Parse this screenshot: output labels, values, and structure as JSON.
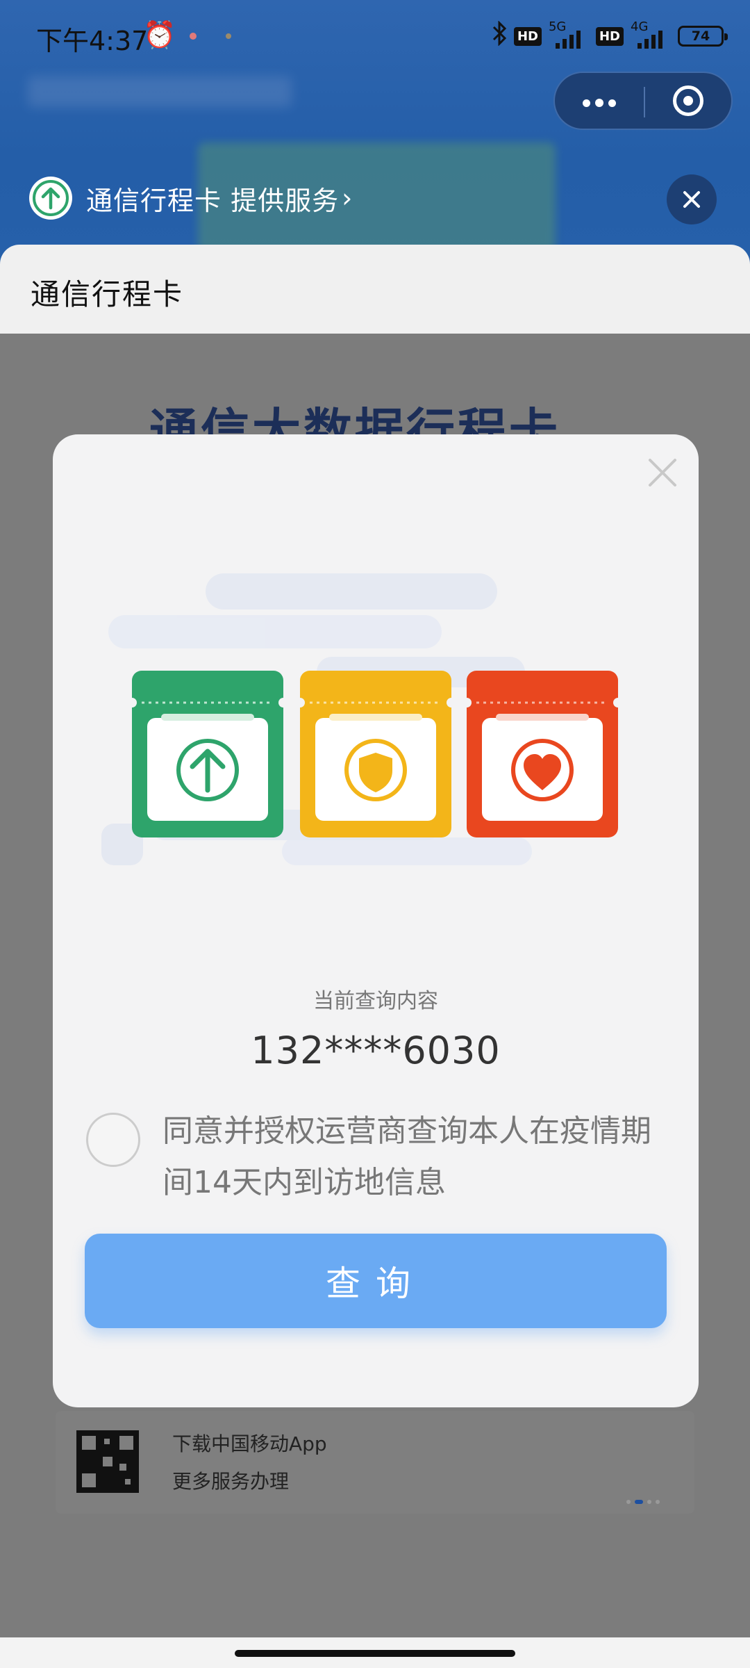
{
  "status_bar": {
    "time": "下午4:37",
    "net1": "5G",
    "net2": "4G",
    "hd": "HD",
    "battery": "74"
  },
  "provider_bar": {
    "text": "通信行程卡 提供服务",
    "chevron": "›"
  },
  "sheet": {
    "title": "通信行程卡",
    "background_heading": "通信大数据行程卡"
  },
  "modal": {
    "current_query_label": "当前查询内容",
    "phone_number": "132****6030",
    "consent_text": "同意并授权运营商查询本人在疫情期间14天内到访地信息",
    "query_button": "查询"
  },
  "bottom_card": {
    "line1": "下载中国移动App",
    "line2": "更多服务办理"
  },
  "colors": {
    "header_blue": "#2660aa",
    "green": "#2ea46b",
    "yellow": "#f3b519",
    "red": "#e9471f",
    "button_blue": "#6aaaf3"
  },
  "icons": [
    "alarm-icon",
    "bluetooth-icon",
    "signal-icon",
    "battery-icon",
    "more-icon",
    "target-icon",
    "arrow-up-icon",
    "close-icon",
    "shield-icon",
    "heart-icon",
    "qr-code-icon"
  ]
}
